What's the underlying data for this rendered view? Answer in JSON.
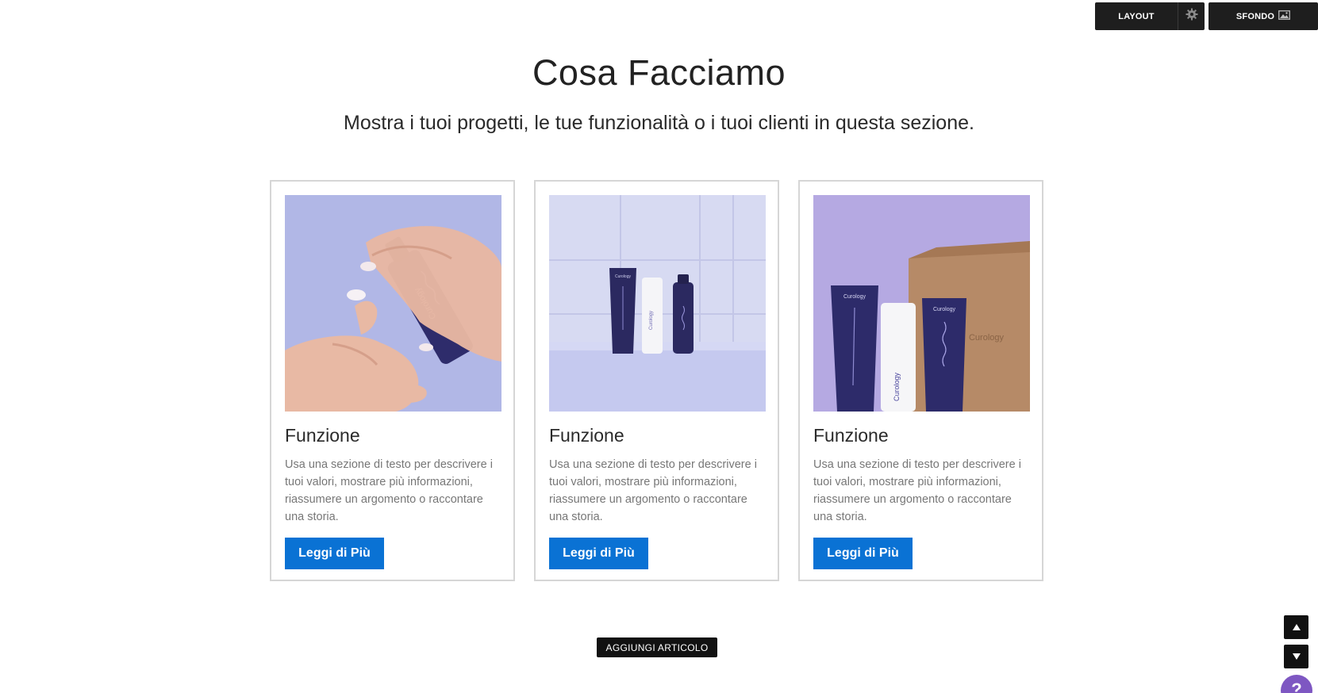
{
  "toolbar": {
    "layout_label": "LAYOUT",
    "gear_icon": "gear-icon",
    "sfondo_label": "SFONDO",
    "image_icon": "image-icon"
  },
  "header": {
    "title": "Cosa Facciamo",
    "subtitle": "Mostra i tuoi progetti, le tue funzionalità o i tuoi clienti in questa sezione."
  },
  "cards": [
    {
      "title": "Funzione",
      "text": "Usa una sezione di testo per descrivere i tuoi valori, mostrare più informazioni, riassumere un argomento o raccontare una storia.",
      "button": "Leggi di Più"
    },
    {
      "title": "Funzione",
      "text": "Usa una sezione di testo per descrivere i tuoi valori, mostrare più informazioni, riassumere un argomento o raccontare una storia.",
      "button": "Leggi di Più"
    },
    {
      "title": "Funzione",
      "text": "Usa una sezione di testo per descrivere i tuoi valori, mostrare più informazioni, riassumere un argomento o raccontare una storia.",
      "button": "Leggi di Più"
    }
  ],
  "add_article": "AGGIUNGI ARTICOLO",
  "help_label": "?",
  "colors": {
    "button_blue": "#0a72d4",
    "toolbar_dark": "#1e1e1e",
    "help_purple": "#7e57c2"
  }
}
